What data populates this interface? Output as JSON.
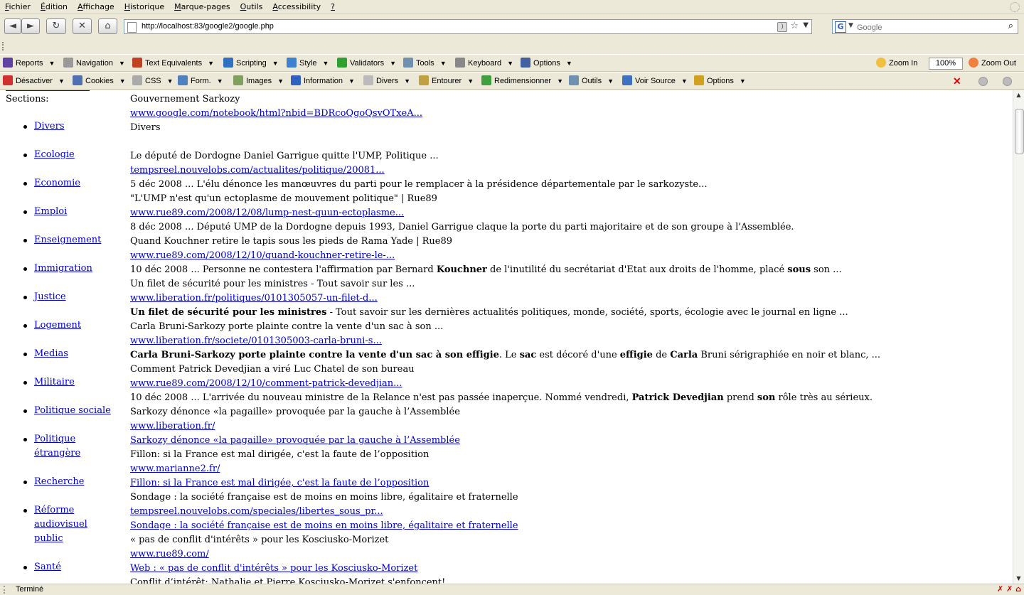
{
  "menubar": {
    "items": [
      {
        "pre": "",
        "u": "F",
        "post": "ichier"
      },
      {
        "pre": "",
        "u": "É",
        "post": "dition"
      },
      {
        "pre": "",
        "u": "A",
        "post": "ffichage"
      },
      {
        "pre": "",
        "u": "H",
        "post": "istorique"
      },
      {
        "pre": "",
        "u": "M",
        "post": "arque-pages"
      },
      {
        "pre": "",
        "u": "O",
        "post": "utils"
      },
      {
        "pre": "",
        "u": "A",
        "post": "ccessibility"
      },
      {
        "pre": "",
        "u": "?",
        "post": ""
      }
    ]
  },
  "navbar": {
    "back": "◄",
    "forward": "►",
    "reload": "↻",
    "stop": "✕",
    "home": "⌂",
    "url": "http://localhost:83/google2/google.php",
    "search_placeholder": "Google",
    "search_engine_letter": "G"
  },
  "webdev_toolbar": {
    "items": [
      "Reports",
      "Navigation",
      "Text Equivalents",
      "Scripting",
      "Style",
      "Validators",
      "Tools",
      "Keyboard",
      "Options"
    ],
    "zoom_in": "Zoom In",
    "zoom_value": "100%",
    "zoom_out": "Zoom Out"
  },
  "firebug_toolbar": {
    "items": [
      "Désactiver",
      "Cookies",
      "CSS",
      "Form.",
      "Images",
      "Information",
      "Divers",
      "Entourer",
      "Redimensionner",
      "Outils",
      "Voir Source",
      "Options"
    ]
  },
  "page": {
    "sections_label": "Sections:",
    "sections": [
      "Divers",
      "Ecologie",
      "Economie",
      "Emploi",
      "Enseignement",
      "Immigration",
      "Justice",
      "Logement",
      "Medias",
      "Militaire",
      "Politique sociale",
      "Politique étrangère",
      "Recherche",
      "Réforme audiovisuel public",
      "Santé"
    ],
    "results": [
      [
        {
          "t": "Gouvernement Sarkozy"
        }
      ],
      [
        {
          "t": "www.google.com/notebook/html?nbid=BDRcoQgoQsvOTxeA...",
          "link": true
        }
      ],
      [
        {
          "t": "Divers"
        }
      ],
      [
        {
          "t": ""
        }
      ],
      [
        {
          "t": "Le député de Dordogne Daniel Garrigue quitte l'UMP, Politique ..."
        }
      ],
      [
        {
          "t": "tempsreel.nouvelobs.com/actualites/politique/20081...",
          "link": true
        }
      ],
      [
        {
          "t": "5 déc 2008 ... L'élu dénonce les manœuvres du parti pour le remplacer à la présidence départementale par le sarkozyste..."
        }
      ],
      [
        {
          "t": "\"L'UMP n'est qu'un ectoplasme de mouvement politique\" | Rue89"
        }
      ],
      [
        {
          "t": "www.rue89.com/2008/12/08/lump-nest-quun-ectoplasme...",
          "link": true
        }
      ],
      [
        {
          "t": "8 déc 2008 ... Député UMP de la Dordogne depuis 1993, Daniel Garrigue claque la porte du parti majoritaire et de son groupe à l'Assemblée."
        }
      ],
      [
        {
          "t": "Quand Kouchner retire le tapis sous les pieds de Rama Yade | Rue89"
        }
      ],
      [
        {
          "t": "www.rue89.com/2008/12/10/quand-kouchner-retire-le-...",
          "link": true
        }
      ],
      [
        {
          "t": "10 déc 2008 ... Personne ne contestera l'affirmation par Bernard "
        },
        {
          "t": "Kouchner",
          "b": true
        },
        {
          "t": " de l'inutilité du secrétariat d'Etat aux droits de l'homme, placé "
        },
        {
          "t": "sous",
          "b": true
        },
        {
          "t": " son ..."
        }
      ],
      [
        {
          "t": "Un filet de sécurité pour les ministres - Tout savoir sur les ..."
        }
      ],
      [
        {
          "t": "www.liberation.fr/politiques/0101305057-un-filet-d...",
          "link": true
        }
      ],
      [
        {
          "t": "Un filet de sécurité pour les ministres",
          "b": true
        },
        {
          "t": " - Tout savoir sur les dernières actualités politiques, monde, société, sports, écologie avec le journal en ligne ..."
        }
      ],
      [
        {
          "t": "Carla Bruni-Sarkozy porte plainte contre la vente d'un sac à son ..."
        }
      ],
      [
        {
          "t": "www.liberation.fr/societe/0101305003-carla-bruni-s...",
          "link": true
        }
      ],
      [
        {
          "t": "Carla Bruni-Sarkozy porte plainte contre la vente d'un sac à son effigie",
          "b": true
        },
        {
          "t": ". Le "
        },
        {
          "t": "sac",
          "b": true
        },
        {
          "t": " est décoré d'une "
        },
        {
          "t": "effigie",
          "b": true
        },
        {
          "t": " de "
        },
        {
          "t": "Carla",
          "b": true
        },
        {
          "t": " Bruni sérigraphiée en noir et blanc, ..."
        }
      ],
      [
        {
          "t": "Comment Patrick Devedjian a viré Luc Chatel de son bureau"
        }
      ],
      [
        {
          "t": "www.rue89.com/2008/12/10/comment-patrick-devedjian...",
          "link": true
        }
      ],
      [
        {
          "t": "10 déc 2008 ... L'arrivée du nouveau ministre de la Relance n'est pas passée inaperçue. Nommé vendredi, "
        },
        {
          "t": "Patrick Devedjian",
          "b": true
        },
        {
          "t": " prend "
        },
        {
          "t": "son",
          "b": true
        },
        {
          "t": " rôle très au sérieux."
        }
      ],
      [
        {
          "t": "Sarkozy dénonce «la pagaille» provoquée par la gauche à l’Assemblée"
        }
      ],
      [
        {
          "t": "www.liberation.fr/",
          "link": true
        }
      ],
      [
        {
          "t": "Sarkozy dénonce «la pagaille» provoquée par la gauche à l’Assemblée",
          "link": true
        }
      ],
      [
        {
          "t": "Fillon: si la France est mal dirigée, c'est la faute de l’opposition"
        }
      ],
      [
        {
          "t": "www.marianne2.fr/",
          "link": true
        }
      ],
      [
        {
          "t": "Fillon: si la France est mal dirigée, c'est la faute de l’opposition",
          "link": true
        }
      ],
      [
        {
          "t": "Sondage : la société française est de moins en moins libre, égalitaire et fraternelle"
        }
      ],
      [
        {
          "t": "tempsreel.nouvelobs.com/speciales/libertes_sous_pr...",
          "link": true
        }
      ],
      [
        {
          "t": "Sondage : la société française est de moins en moins libre, égalitaire et fraternelle",
          "link": true
        }
      ],
      [
        {
          "t": "« pas de conflit d'intérêts » pour les Kosciusko-Morizet"
        }
      ],
      [
        {
          "t": "www.rue89.com/",
          "link": true
        }
      ],
      [
        {
          "t": "Web : « pas de conflit d'intérêts » pour les Kosciusko-Morizet",
          "link": true
        }
      ],
      [
        {
          "t": "Conflit d’intérêt: Nathalie et Pierre Kosciusko-Morizet s'enfoncent!"
        }
      ]
    ]
  },
  "statusbar": {
    "text": "Terminé"
  }
}
